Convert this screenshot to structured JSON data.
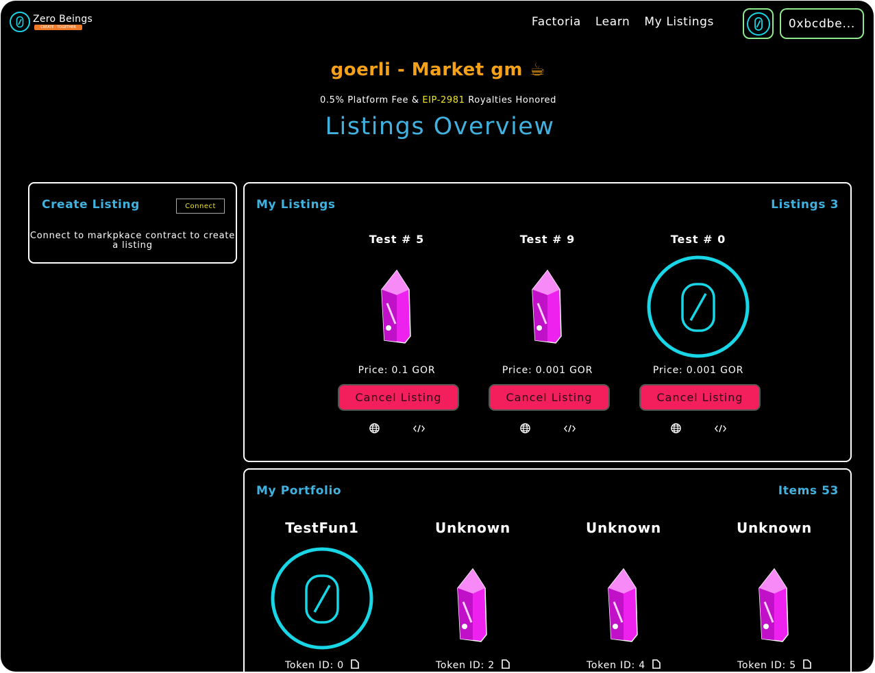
{
  "nav": {
    "brand": "Zero Beings",
    "brand_badge": "CREATE · TOGETHER",
    "links": [
      "Factoria",
      "Learn",
      "My Listings"
    ],
    "wallet": "0xbcdbe..."
  },
  "header": {
    "market_title": "goerli - Market gm ☕",
    "fee_prefix": "0.5% Platform Fee & ",
    "fee_link": "EIP-2981",
    "fee_suffix": " Royalties Honored",
    "overview_title": "Listings Overview"
  },
  "create_listing": {
    "title": "Create Listing",
    "connect_label": "Connect",
    "message": "Connect to markpkace contract to create a listing"
  },
  "my_listings": {
    "title": "My Listings",
    "count_label": "Listings 3",
    "items": [
      {
        "name": "Test # 5",
        "price": "Price: 0.1 GOR",
        "image": "crystal",
        "cancel_label": "Cancel Listing"
      },
      {
        "name": "Test # 9",
        "price": "Price: 0.001 GOR",
        "image": "crystal",
        "cancel_label": "Cancel Listing"
      },
      {
        "name": "Test # 0",
        "price": "Price: 0.001 GOR",
        "image": "zero-ring",
        "cancel_label": "Cancel Listing"
      }
    ]
  },
  "portfolio": {
    "title": "My Portfolio",
    "count_label": "Items 53",
    "items": [
      {
        "name": "TestFun1",
        "token": "Token ID: 0",
        "image": "zero-ring"
      },
      {
        "name": "Unknown",
        "token": "Token ID: 2",
        "image": "crystal"
      },
      {
        "name": "Unknown",
        "token": "Token ID: 4",
        "image": "crystal"
      },
      {
        "name": "Unknown",
        "token": "Token ID: 5",
        "image": "crystal"
      }
    ]
  },
  "colors": {
    "accent_blue": "#41b2df",
    "market_orange": "#f5a21a",
    "cancel_pink": "#f21f5c",
    "ring_cyan": "#19d6e6",
    "crystal_magenta": "#ee22ee"
  }
}
